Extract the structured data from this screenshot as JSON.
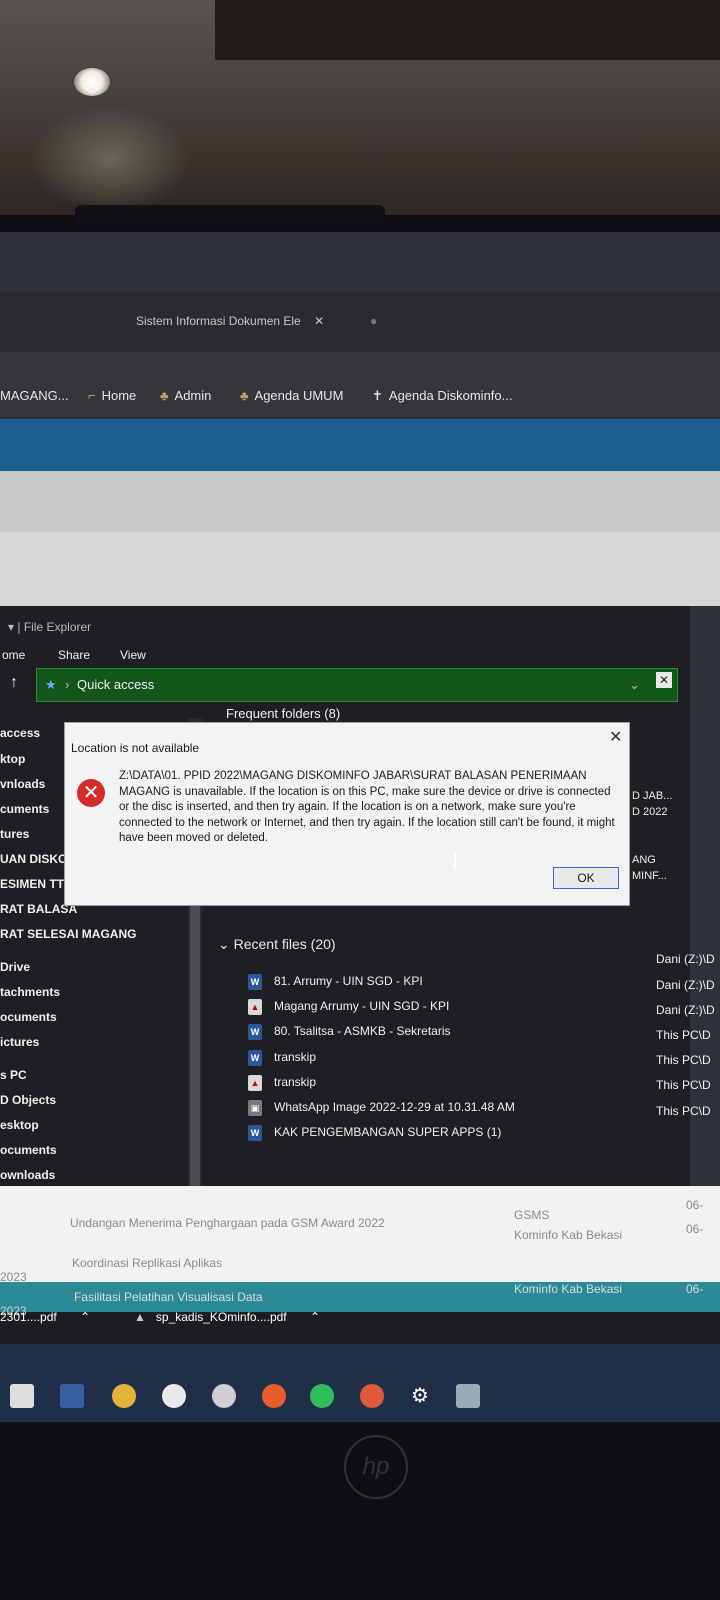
{
  "browser": {
    "tabs": [
      "Sistem Informasi Dokumen Ele"
    ],
    "bookmarks": [
      "MAGANG...",
      "Home",
      "Admin",
      "Agenda UMUM",
      "Agenda Diskominfo..."
    ]
  },
  "explorer": {
    "title": "File Explorer",
    "ribbon": [
      "ome",
      "Share",
      "View"
    ],
    "address": "Quick access",
    "nav_items": [
      "access",
      "ktop",
      "vnloads",
      "cuments",
      "tures",
      "UAN DISKC",
      "ESIMEN TTE",
      "RAT BALASA",
      "RAT SELESAI MAGANG",
      "Drive",
      "tachments",
      "ocuments",
      "ictures",
      "s PC",
      "D Objects",
      "esktop",
      "ocuments",
      "ownloads"
    ],
    "frequent_header": "Frequent folders (8)",
    "tile_texts": [
      "D JAB...",
      "D 2022",
      "ANG",
      "MINF..."
    ],
    "recent_header": "Recent files (20)",
    "recent_files": [
      {
        "name": "81. Arrumy - UIN SGD - KPI",
        "type": "word",
        "location": "Dani (Z:)\\D"
      },
      {
        "name": "Magang Arrumy - UIN SGD - KPI",
        "type": "pdf",
        "location": "Dani (Z:)\\D"
      },
      {
        "name": "80. Tsalitsa - ASMKB - Sekretaris",
        "type": "word",
        "location": "Dani (Z:)\\D"
      },
      {
        "name": "transkip",
        "type": "word",
        "location": "This PC\\D"
      },
      {
        "name": "transkip",
        "type": "pdf",
        "location": "This PC\\D"
      },
      {
        "name": "WhatsApp Image 2022-12-29 at 10.31.48 AM",
        "type": "img",
        "location": "This PC\\D"
      },
      {
        "name": "KAK PENGEMBANGAN SUPER APPS (1)",
        "type": "word",
        "location": "This PC\\D"
      }
    ]
  },
  "dialog": {
    "title": "Location is not available",
    "message": "Z:\\DATA\\01. PPID 2022\\MAGANG DISKOMINFO JABAR\\SURAT BALASAN PENERIMAAN MAGANG is unavailable. If the location is on this PC, make sure the device or drive is connected or the disc is inserted, and then try again. If the location is on a network, make sure you're connected to the network or Internet, and then try again. If the location still can't be found, it might have been moved or deleted.",
    "ok_label": "OK"
  },
  "web_list": [
    {
      "date": "",
      "title": "Undangan Menerima Penghargaan pada GSM Award 2022",
      "source": "GSMS",
      "time": "06-"
    },
    {
      "date": "2023",
      "title": "Koordinasi Replikasi Aplikas",
      "source": "Kominfo Kab Bekasi",
      "time": "06-"
    },
    {
      "date": "2023",
      "title": "Fasilitasi Pelatihan Visualisasi Data",
      "source": "Kominfo Kab Bekasi",
      "time": "06-"
    }
  ],
  "downloads": [
    "2301....pdf",
    "sp_kadis_KOminfo....pdf"
  ],
  "brand": "hp"
}
